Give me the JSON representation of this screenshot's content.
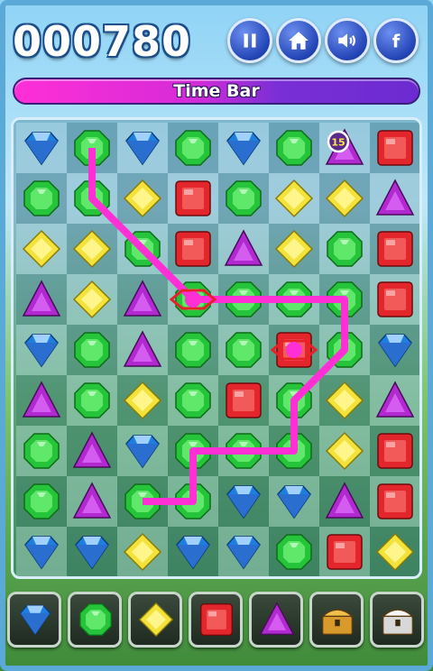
{
  "header": {
    "score": "000780",
    "buttons": [
      {
        "name": "pause-button",
        "icon": "pause-icon"
      },
      {
        "name": "home-button",
        "icon": "home-icon"
      },
      {
        "name": "sound-button",
        "icon": "speaker-icon"
      },
      {
        "name": "facebook-button",
        "icon": "facebook-icon"
      }
    ]
  },
  "timebar": {
    "label": "Time Bar"
  },
  "board": {
    "rows": 9,
    "cols": 8,
    "grid": [
      [
        "blue",
        "green",
        "blue",
        "green",
        "blue",
        "green",
        "purple",
        "red"
      ],
      [
        "green",
        "green",
        "yellow",
        "red",
        "green",
        "yellow",
        "yellow",
        "purple"
      ],
      [
        "yellow",
        "yellow",
        "green",
        "red",
        "purple",
        "yellow",
        "green",
        "red"
      ],
      [
        "purple",
        "yellow",
        "purple",
        "green",
        "green",
        "green",
        "green",
        "red"
      ],
      [
        "blue",
        "green",
        "purple",
        "green",
        "green",
        "red",
        "green",
        "blue"
      ],
      [
        "purple",
        "green",
        "yellow",
        "green",
        "red",
        "green",
        "yellow",
        "purple"
      ],
      [
        "green",
        "purple",
        "blue",
        "green",
        "green",
        "green",
        "yellow",
        "red"
      ],
      [
        "green",
        "purple",
        "green",
        "green",
        "blue",
        "blue",
        "purple",
        "red"
      ],
      [
        "blue",
        "blue",
        "yellow",
        "blue",
        "blue",
        "green",
        "red",
        "yellow"
      ]
    ],
    "timer_badge": "15",
    "selection_path": [
      [
        0,
        1
      ],
      [
        1,
        1
      ],
      [
        2,
        2
      ],
      [
        3,
        3
      ],
      [
        3,
        4
      ],
      [
        3,
        5
      ],
      [
        3,
        6
      ],
      [
        4,
        6
      ],
      [
        5,
        5
      ],
      [
        6,
        5
      ],
      [
        6,
        4
      ],
      [
        6,
        3
      ],
      [
        7,
        3
      ],
      [
        7,
        2
      ]
    ],
    "marked_cells": [
      [
        3,
        3
      ],
      [
        4,
        5
      ]
    ]
  },
  "tray": [
    {
      "name": "tray-blue-gem",
      "gem": "blue"
    },
    {
      "name": "tray-green-gem",
      "gem": "green"
    },
    {
      "name": "tray-yellow-gem",
      "gem": "yellow"
    },
    {
      "name": "tray-red-gem",
      "gem": "red"
    },
    {
      "name": "tray-purple-gem",
      "gem": "purple"
    },
    {
      "name": "tray-gold-chest",
      "gem": "chest-gold"
    },
    {
      "name": "tray-silver-chest",
      "gem": "chest-silver"
    }
  ],
  "colors": {
    "blue": "#1f7fe0",
    "green": "#26c43a",
    "yellow": "#f2e23a",
    "red": "#e3262b",
    "purple": "#b02ad0",
    "link": "#ff2fd6"
  }
}
